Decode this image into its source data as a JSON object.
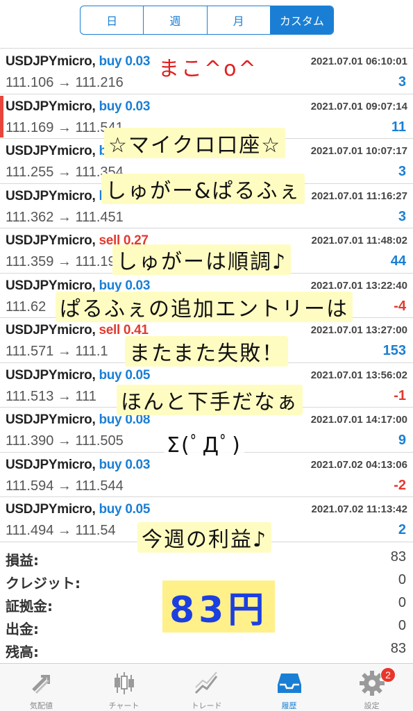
{
  "segment": {
    "items": [
      "日",
      "週",
      "月",
      "カスタム"
    ],
    "active_index": 3
  },
  "trades": [
    {
      "symbol": "USDJPYmicro,",
      "side": "buy",
      "lots": "0.03",
      "prices": "111.106 → 111.216",
      "time": "2021.07.01 06:10:01",
      "profit": "3"
    },
    {
      "symbol": "USDJPYmicro,",
      "side": "buy",
      "lots": "0.03",
      "prices": "111.169 → 111.541",
      "time": "2021.07.01 09:07:14",
      "profit": "11"
    },
    {
      "symbol": "USDJPYmicro,",
      "side": "buy",
      "lots": "0.03",
      "prices": "111.255 → 111.354",
      "time": "2021.07.01 10:07:17",
      "profit": "3"
    },
    {
      "symbol": "USDJPYmicro,",
      "side": "buy",
      "lots": "0.03",
      "prices": "111.362 → 111.451",
      "time": "2021.07.01 11:16:27",
      "profit": "3"
    },
    {
      "symbol": "USDJPYmicro,",
      "side": "sell",
      "lots": "0.27",
      "prices": "111.359 → 111.19",
      "time": "2021.07.01 11:48:02",
      "profit": "44"
    },
    {
      "symbol": "USDJPYmicro,",
      "side": "buy",
      "lots": "0.03",
      "prices": "111.62",
      "time": "2021.07.01 13:22:40",
      "profit": "-4"
    },
    {
      "symbol": "USDJPYmicro,",
      "side": "sell",
      "lots": "0.41",
      "prices": "111.571 → 111.1",
      "time": "2021.07.01 13:27:00",
      "profit": "153"
    },
    {
      "symbol": "USDJPYmicro,",
      "side": "buy",
      "lots": "0.05",
      "prices": "111.513 → 111",
      "time": "2021.07.01 13:56:02",
      "profit": "-1"
    },
    {
      "symbol": "USDJPYmicro,",
      "side": "buy",
      "lots": "0.08",
      "prices": "111.390 → 111.505",
      "time": "2021.07.01 14:17:00",
      "profit": "9"
    },
    {
      "symbol": "USDJPYmicro,",
      "side": "buy",
      "lots": "0.03",
      "prices": "111.594 → 111.544",
      "time": "2021.07.02 04:13:06",
      "profit": "-2"
    },
    {
      "symbol": "USDJPYmicro,",
      "side": "buy",
      "lots": "0.05",
      "prices": "111.494 → 111.54",
      "time": "2021.07.02 11:13:42",
      "profit": "2"
    }
  ],
  "summary": [
    {
      "label": "損益:",
      "value": "83"
    },
    {
      "label": "クレジット:",
      "value": "0"
    },
    {
      "label": "証拠金:",
      "value": "0"
    },
    {
      "label": "出金:",
      "value": "0"
    },
    {
      "label": "残高:",
      "value": "83"
    }
  ],
  "annotations": {
    "author": "まこ^o^",
    "line1": "☆マイクロ口座☆",
    "line2": "しゅがー&ぱるふぇ",
    "line3": "しゅがーは順調♪",
    "line4": "ぱるふぇの追加エントリーは",
    "line5": "またまた失敗！",
    "line6": "ほんと下手だなぁ",
    "line7": "Σ(ﾟДﾟ)",
    "line8": "今週の利益♪",
    "total": "83円"
  },
  "tabs": [
    {
      "label": "気配値",
      "icon": "quotes-arrows-icon"
    },
    {
      "label": "チャート",
      "icon": "candlestick-chart-icon"
    },
    {
      "label": "トレード",
      "icon": "trade-line-icon"
    },
    {
      "label": "履歴",
      "icon": "history-inbox-icon"
    },
    {
      "label": "設定",
      "icon": "gear-icon",
      "badge": "2"
    }
  ],
  "colors": {
    "accent": "#1a7fd4",
    "sell": "#e23a2e",
    "highlight": "#fffcc2"
  }
}
